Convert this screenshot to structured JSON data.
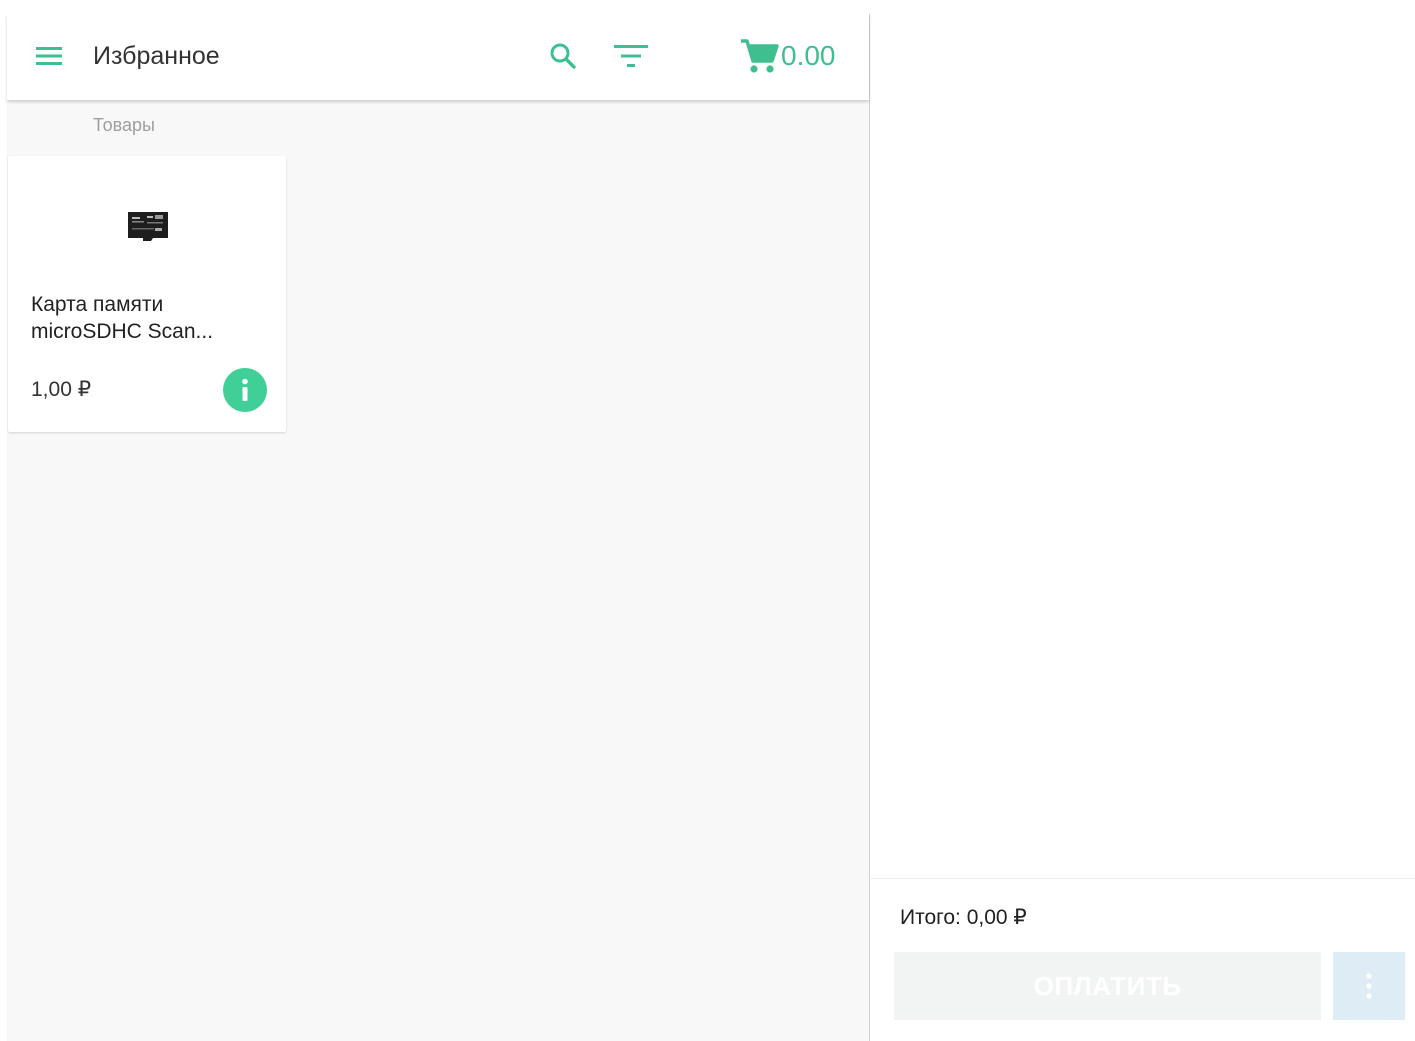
{
  "toolbar": {
    "title": "Избранное",
    "cart_total": "0.00",
    "icons": {
      "menu": "menu-icon",
      "search": "search-icon",
      "filter": "filter-icon",
      "cart": "cart-icon"
    }
  },
  "section": {
    "label": "Товары"
  },
  "products": [
    {
      "name_line1": "Карта памяти",
      "name_line2": "microSDHC Scan...",
      "price": "1,00 ₽",
      "image_icon": "microsd-card-icon"
    }
  ],
  "summary": {
    "total_text": "Итого: 0,00 ₽",
    "pay_label": "ОПЛАТИТЬ"
  },
  "colors": {
    "accent": "#3fbf8f",
    "info_button": "#3fcf97",
    "pay_disabled_bg": "#f2f3f3",
    "more_button_bg": "#deecf6"
  }
}
